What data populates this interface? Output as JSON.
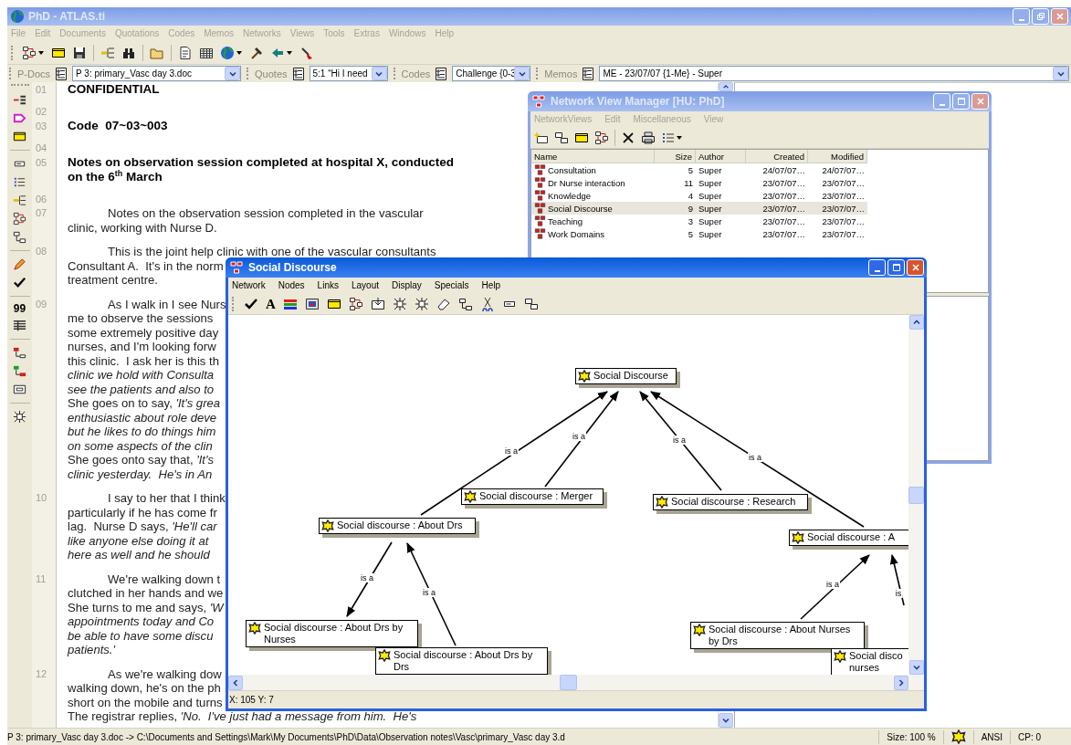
{
  "main_window": {
    "title": "PhD - ATLAS.ti",
    "active": false,
    "menu": [
      "File",
      "Edit",
      "Documents",
      "Quotations",
      "Codes",
      "Memos",
      "Networks",
      "Views",
      "Tools",
      "Extras",
      "Windows",
      "Help"
    ],
    "selectors": [
      {
        "label": "P-Docs",
        "value": "P 3: primary_Vasc day 3.doc"
      },
      {
        "label": "Quotes",
        "value": "5:1 “Hi I need"
      },
      {
        "label": "Codes",
        "value": "Challenge {0-3"
      },
      {
        "label": "Memos",
        "value": "ME - 23/07/07 {1-Me} - Super"
      }
    ],
    "side_toolbar": {
      "quote_label": "99"
    },
    "document": {
      "rows": [
        {
          "number": "01",
          "kind": "heading",
          "lines": [
            {
              "text": "CONFIDENTIAL",
              "italic": false
            }
          ]
        },
        {
          "number": "02",
          "kind": "blank"
        },
        {
          "number": "03",
          "kind": "heading",
          "lines": [
            {
              "text": "Code  07~03~003",
              "italic": false
            }
          ]
        },
        {
          "number": "04",
          "kind": "blank"
        },
        {
          "number": "05",
          "kind": "heading",
          "lines": [
            {
              "text": "Notes on observation session completed at hospital X, conducted",
              "italic": false
            },
            {
              "text": "on the 6$^{th}$ March",
              "italic": false
            }
          ]
        },
        {
          "number": "06",
          "kind": "blank"
        },
        {
          "number": "07",
          "kind": "body",
          "lines": [
            {
              "text": "Notes on the observation session completed in the vascular",
              "italic": false
            },
            {
              "text": "clinic, working with Nurse D.",
              "italic": false
            }
          ]
        },
        {
          "number": "08",
          "kind": "body",
          "lines": [
            {
              "text": "This is the joint help clinic with one of the vascular consultants",
              "italic": false
            },
            {
              "text": "Consultant A.  It's in the norm",
              "italic": false
            },
            {
              "text": "treatment centre.",
              "italic": false
            }
          ]
        },
        {
          "number": "09",
          "kind": "body",
          "lines": [
            {
              "text": "As I walk in I see Nurs",
              "italic": false
            },
            {
              "text": "me to observe the sessions",
              "italic": false
            },
            {
              "text": "some extremely positive day",
              "italic": false
            },
            {
              "text": "nurses, and I'm looking forw",
              "italic": false
            },
            {
              "text": "this clinic.  I ask her is this th",
              "italic": false
            },
            {
              "text": "clinic we hold with Consulta",
              "italic": true
            },
            {
              "text": "see the patients and also to",
              "italic": true
            },
            {
              "text": "She goes on to say, *'It's grea*",
              "italic": false
            },
            {
              "text": "enthusiastic about role deve",
              "italic": true
            },
            {
              "text": "but he likes to do things him",
              "italic": true
            },
            {
              "text": "on some aspects of the clin",
              "italic": true
            },
            {
              "text": "She goes onto say that, *'It's*",
              "italic": false
            },
            {
              "text": "clinic yesterday.  He's in An",
              "italic": true
            }
          ]
        },
        {
          "number": "10",
          "kind": "body",
          "lines": [
            {
              "text": "I say to her that I think",
              "italic": false
            },
            {
              "text": "particularly if he has come fr",
              "italic": false
            },
            {
              "text": "lag.  Nurse D says, *'He'll car*",
              "italic": false
            },
            {
              "text": "like anyone else doing it at",
              "italic": true
            },
            {
              "text": "here as well and he should",
              "italic": true
            }
          ]
        },
        {
          "number": "11",
          "kind": "body",
          "lines": [
            {
              "text": "We're walking down t",
              "italic": false
            },
            {
              "text": "clutched in her hands and we",
              "italic": false
            },
            {
              "text": "She turns to me and says, *'W*",
              "italic": false
            },
            {
              "text": "appointments today and Co",
              "italic": true
            },
            {
              "text": "be able to have some discu",
              "italic": true
            },
            {
              "text": "patients.'",
              "italic": true
            }
          ]
        },
        {
          "number": "12",
          "kind": "body",
          "lines": [
            {
              "text": "As we're walking dow",
              "italic": false
            },
            {
              "text": "walking down, he's on the ph",
              "italic": false
            },
            {
              "text": "short on the mobile and turns",
              "italic": false
            },
            {
              "text": "The registrar replies, *'No.  I've just had a message from him.  He's*",
              "italic": false
            }
          ]
        }
      ]
    },
    "status_bar": {
      "path": "P 3: primary_Vasc day 3.doc -> C:\\Documents and Settings\\Mark\\My Documents\\PhD\\Data\\Observation notes\\Vasc\\primary_Vasc day 3.d",
      "zoom": "Size: 100 %",
      "encoding": "ANSI",
      "position": "CP: 0"
    }
  },
  "network_view_manager": {
    "title": "Network View Manager [HU: PhD]",
    "active": false,
    "menu": [
      "NetworkViews",
      "Edit",
      "Miscellaneous",
      "View"
    ],
    "columns": [
      "Name",
      "Size",
      "Author",
      "Created",
      "Modified"
    ],
    "rows": [
      {
        "name": "Consultation",
        "size": "5",
        "author": "Super",
        "created": "24/07/07…",
        "modified": "24/07/07…",
        "selected": false
      },
      {
        "name": "Dr Nurse interaction",
        "size": "11",
        "author": "Super",
        "created": "23/07/07…",
        "modified": "23/07/07…",
        "selected": false
      },
      {
        "name": "Knowledge",
        "size": "4",
        "author": "Super",
        "created": "23/07/07…",
        "modified": "23/07/07…",
        "selected": false
      },
      {
        "name": "Social Discourse",
        "size": "9",
        "author": "Super",
        "created": "23/07/07…",
        "modified": "23/07/07…",
        "selected": true
      },
      {
        "name": "Teaching",
        "size": "3",
        "author": "Super",
        "created": "23/07/07…",
        "modified": "23/07/07…",
        "selected": false
      },
      {
        "name": "Work Domains",
        "size": "5",
        "author": "Super",
        "created": "23/07/07…",
        "modified": "23/07/07…",
        "selected": false
      }
    ]
  },
  "network_editor": {
    "title": "Social Discourse",
    "active": true,
    "menu": [
      "Network",
      "Nodes",
      "Links",
      "Layout",
      "Display",
      "Specials",
      "Help"
    ],
    "font_button": "A",
    "nodes": [
      {
        "lines": [
          "Social Discourse"
        ]
      },
      {
        "lines": [
          "Social discourse : Merger"
        ]
      },
      {
        "lines": [
          "Social discourse : About Drs"
        ]
      },
      {
        "lines": [
          "Social discourse : Research"
        ]
      },
      {
        "lines": [
          "Social discourse : A"
        ]
      },
      {
        "lines": [
          "Social discourse : About Drs by",
          "Nurses"
        ]
      },
      {
        "lines": [
          "Social discourse : About Drs by",
          "Drs"
        ]
      },
      {
        "lines": [
          "Social discourse : About Nurses",
          "by Drs"
        ]
      },
      {
        "lines": [
          "Social disco",
          "nurses"
        ]
      }
    ],
    "links": [
      {
        "label": "is a"
      },
      {
        "label": "is a"
      },
      {
        "label": "is a"
      },
      {
        "label": "is a"
      },
      {
        "label": "is a"
      },
      {
        "label": "is a"
      },
      {
        "label": "is a"
      },
      {
        "label": "is"
      }
    ],
    "status": "X: 105 Y: 7"
  }
}
